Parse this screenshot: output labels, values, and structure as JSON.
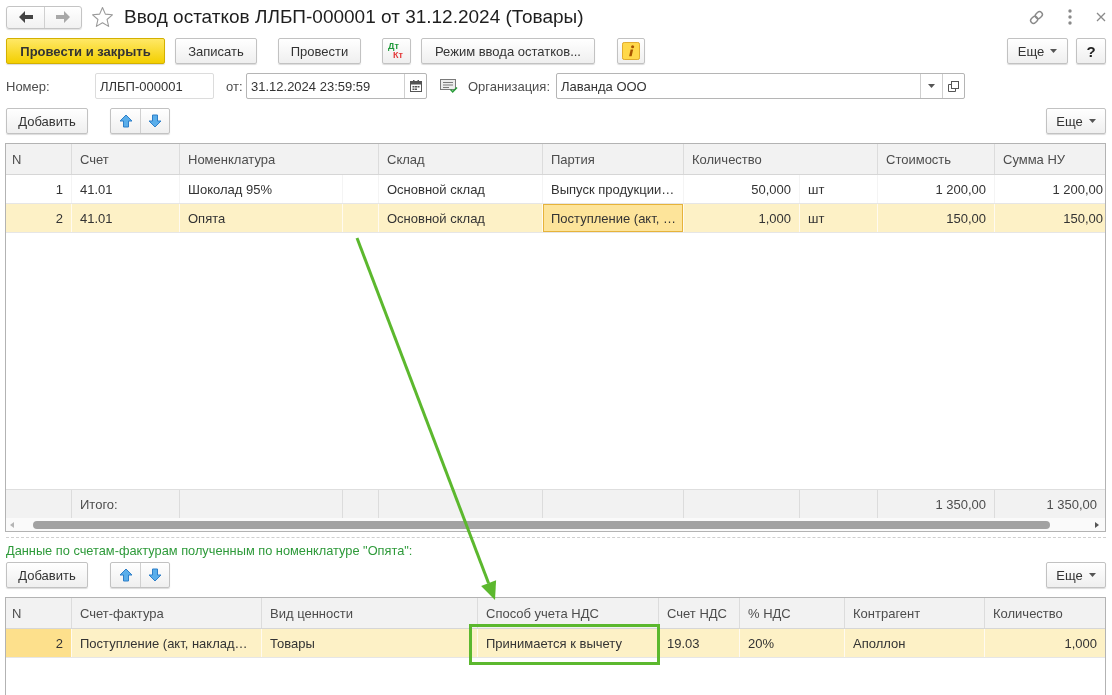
{
  "window": {
    "title": "Ввод остатков ЛЛБП-000001 от 31.12.2024 (Товары)",
    "favorite": false,
    "navigation": {
      "back": {
        "disabled": false
      },
      "forward": {
        "disabled": true
      }
    }
  },
  "toolbar": {
    "items": [
      {
        "kind": "primary",
        "label": "Провести и закрыть"
      },
      {
        "kind": "button",
        "label": "Записать"
      },
      {
        "kind": "button",
        "label": "Провести"
      },
      {
        "kind": "dt-kt",
        "debit": "Дт",
        "credit": "Кт"
      },
      {
        "kind": "button",
        "label": "Режим ввода остатков..."
      },
      {
        "kind": "info"
      }
    ],
    "more": "Еще",
    "help": "?"
  },
  "header_fields": {
    "number": {
      "label": "Номер:",
      "value": "ЛЛБП-000001"
    },
    "date": {
      "label": "от:",
      "value": "31.12.2024 23:59:59"
    },
    "organization": {
      "label": "Организация:",
      "value": "Лаванда ООО"
    }
  },
  "goods": {
    "add": "Добавить",
    "more": "Еще",
    "columns": [
      "N",
      "Счет",
      "Номенклатура",
      "Склад",
      "Партия",
      "Количество",
      "Стоимость",
      "Сумма НУ"
    ],
    "rows": [
      {
        "n": "1",
        "account": "41.01",
        "item": "Шоколад 95%",
        "warehouse": "Основной склад",
        "batch": "Выпуск продукции…",
        "quantity": "50,000",
        "unit": "шт",
        "cost": "1 200,00",
        "tax_sum": "1 200,00",
        "selected": false
      },
      {
        "n": "2",
        "account": "41.01",
        "item": "Опята",
        "warehouse": "Основной склад",
        "batch": "Поступление (акт, …",
        "quantity": "1,000",
        "unit": "шт",
        "cost": "150,00",
        "tax_sum": "150,00",
        "selected": true,
        "current_cell": {
          "batch": true
        }
      }
    ],
    "totals": {
      "label": "Итого:",
      "cost": "1 350,00",
      "tax_sum": "1 350,00"
    }
  },
  "invoices": {
    "caption": "Данные по счетам-фактурам полученным по номенклатуре \"Опята\":",
    "add": "Добавить",
    "more": "Еще",
    "columns": [
      "N",
      "Счет-фактура",
      "Вид ценности",
      "Способ учета НДС",
      "Счет НДС",
      "% НДС",
      "Контрагент",
      "Количество"
    ],
    "rows": [
      {
        "n": "2",
        "invoice": "Поступление (акт, наклад…",
        "value_type": "Товары",
        "vat_method": "Принимается к вычету",
        "vat_account": "19.03",
        "vat_rate": "20%",
        "counterparty": "Аполлон",
        "quantity": "1,000",
        "selected": true,
        "current_cell": {
          "n": true
        }
      }
    ]
  },
  "annotations": {
    "arrow": true,
    "highlight_frame": true
  }
}
